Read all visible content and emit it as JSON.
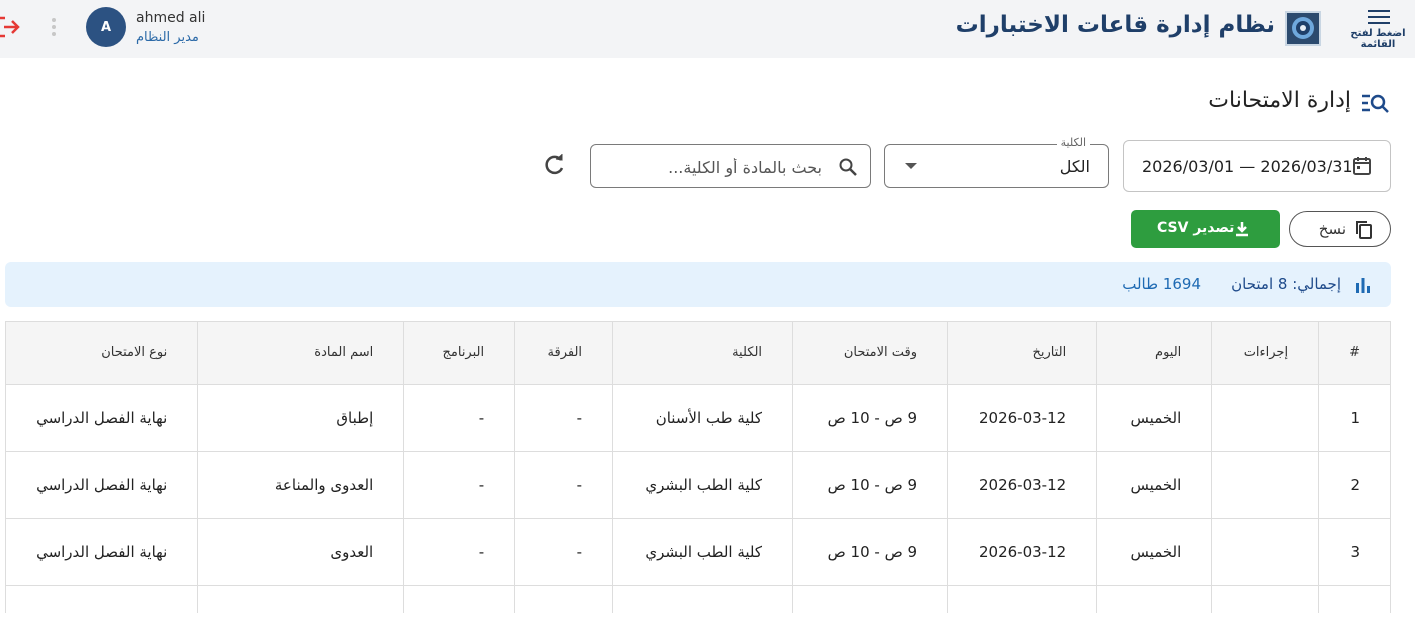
{
  "header": {
    "app_title": "نظام إدارة قاعات الاختبارات",
    "menu_label": "اضغط لفتح القائمة",
    "user_name": "ahmed ali",
    "user_role": "مدير النظام",
    "avatar_letter": "A"
  },
  "page": {
    "title": "إدارة الامتحانات"
  },
  "filters": {
    "date_range": "2026/03/01 — 2026/03/31",
    "faculty_label": "الكلية",
    "faculty_value": "الكل",
    "search_placeholder": "بحث بالمادة أو الكلية..."
  },
  "actions": {
    "copy_label": "نسخ",
    "csv_label": "تصدير CSV"
  },
  "summary": {
    "total": "إجمالي: 8 امتحان",
    "students": "1694 طالب"
  },
  "table": {
    "headers": [
      "#",
      "إجراءات",
      "اليوم",
      "التاريخ",
      "وقت الامتحان",
      "الكلية",
      "الفرقة",
      "البرنامج",
      "اسم المادة",
      "نوع الامتحان"
    ],
    "rows": [
      [
        "1",
        "",
        "الخميس",
        "2026-03-12",
        "9 ص - 10 ص",
        "كلية طب الأسنان",
        "-",
        "-",
        "إطباق",
        "نهاية الفصل الدراسي"
      ],
      [
        "2",
        "",
        "الخميس",
        "2026-03-12",
        "9 ص - 10 ص",
        "كلية الطب البشري",
        "-",
        "-",
        "العدوى والمناعة",
        "نهاية الفصل الدراسي"
      ],
      [
        "3",
        "",
        "الخميس",
        "2026-03-12",
        "9 ص - 10 ص",
        "كلية الطب البشري",
        "-",
        "-",
        "العدوى",
        "نهاية الفصل الدراسي"
      ],
      [
        "",
        "",
        "",
        "",
        "",
        "",
        "",
        "",
        "",
        ""
      ]
    ]
  },
  "colors": {
    "primary": "#1f3f69",
    "success": "#2e9d3f",
    "danger": "#e53935",
    "summary_bg": "#e5f2fd"
  },
  "icons": {
    "logout": "logout-icon",
    "more": "more-vert-icon",
    "menu": "hamburger-icon",
    "page": "manage-search-icon",
    "calendar": "calendar-icon",
    "search": "search-icon",
    "refresh": "refresh-icon",
    "copy": "copy-icon",
    "download": "download-icon",
    "chart": "bar-chart-icon"
  }
}
